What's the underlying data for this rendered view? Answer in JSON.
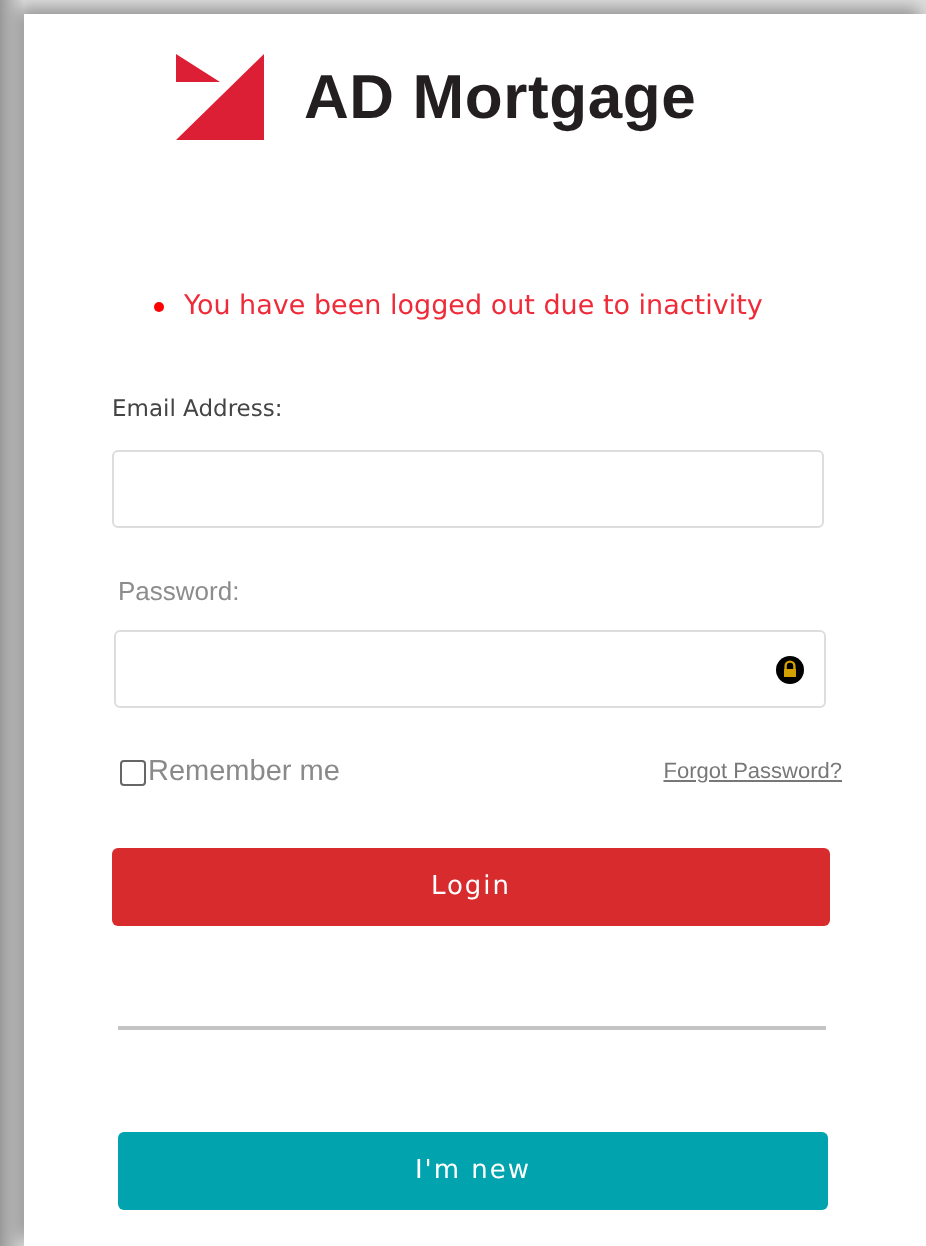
{
  "logo": {
    "text": "AD Mortgage"
  },
  "alert": {
    "message": "You have been logged out due to inactivity"
  },
  "email": {
    "label": "Email Address:"
  },
  "password": {
    "label": "Password:"
  },
  "remember": {
    "label": "Remember me",
    "checked": false
  },
  "forgot": {
    "label": "Forgot Password?"
  },
  "buttons": [
    {
      "kind": "primary",
      "label": "Login"
    },
    {
      "kind": "secondary",
      "label": "I'm new"
    }
  ]
}
